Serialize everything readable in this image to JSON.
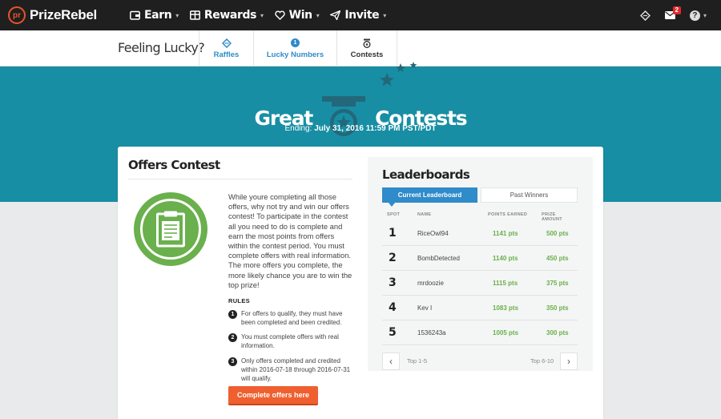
{
  "topnav": {
    "logo_badge": "pr",
    "logo_text": "PrizeRebel",
    "items": [
      {
        "label": "Earn",
        "icon": "wallet-icon"
      },
      {
        "label": "Rewards",
        "icon": "gift-icon"
      },
      {
        "label": "Win",
        "icon": "heart-icon"
      },
      {
        "label": "Invite",
        "icon": "paper-plane-icon"
      }
    ],
    "mail_count": "2",
    "help_glyph": "?",
    "caret": "▾"
  },
  "subnav": {
    "heading": "Feeling Lucky?",
    "tabs": [
      {
        "label": "Raffles",
        "icon": "ticket-icon"
      },
      {
        "label": "Lucky Numbers",
        "icon": "number-badge-icon",
        "badge": "1"
      },
      {
        "label": "Contests",
        "icon": "medal-icon"
      }
    ]
  },
  "hero": {
    "left_word": "Great",
    "right_word": "Contests",
    "ending_label": "Ending:",
    "ending_value": "July 31, 2016 11:59 PM PST/PDT"
  },
  "contest": {
    "title": "Offers Contest",
    "description": "While youre completing all those offers, why not try and win our offers contest! To participate in the contest all you need to do is complete and earn the most points from offers within the contest period. You must complete offers with real information. The more offers you complete, the more likely chance you are to win the top prize!",
    "rules_heading": "RULES",
    "rules": [
      {
        "num": "1",
        "text": "For offers to qualify, they must have been completed and been credited."
      },
      {
        "num": "2",
        "text": "You must complete offers with real information."
      },
      {
        "num": "3",
        "text": "Only offers completed and credited within 2016-07-18 through 2016-07-31 will qualify."
      }
    ],
    "cta_label": "Complete offers here"
  },
  "leaderboard": {
    "title": "Leaderboards",
    "tabs": {
      "current": "Current Leaderboard",
      "past": "Past Winners"
    },
    "columns": {
      "spot": "SPOT",
      "name": "NAME",
      "points": "POINTS EARNED",
      "prize": "PRIZE AMOUNT"
    },
    "rows": [
      {
        "spot": "1",
        "name": "RiceOwl94",
        "points": "1141 pts",
        "prize": "500 pts"
      },
      {
        "spot": "2",
        "name": "BombDetected",
        "points": "1140 pts",
        "prize": "450 pts"
      },
      {
        "spot": "3",
        "name": "mrdoozie",
        "points": "1115 pts",
        "prize": "375 pts"
      },
      {
        "spot": "4",
        "name": "Kev I",
        "points": "1083 pts",
        "prize": "350 pts"
      },
      {
        "spot": "5",
        "name": "1536243a",
        "points": "1005 pts",
        "prize": "300 pts"
      }
    ],
    "pager": {
      "prev_label": "Top 1-5",
      "next_label": "Top 6-10",
      "prev_glyph": "‹",
      "next_glyph": "›"
    }
  },
  "colors": {
    "accent_blue": "#2f8bc9",
    "hero_teal": "#178ea3",
    "points_green": "#6ab04c",
    "cta_orange": "#ef5f2f",
    "nav_dark": "#1f1f1f"
  }
}
